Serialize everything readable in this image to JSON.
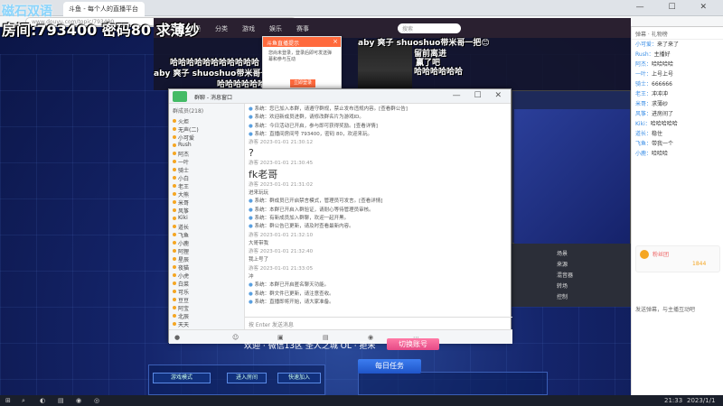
{
  "overlay": {
    "room_label": "房间:",
    "room_number": "793400",
    "password_label": "密码",
    "password_value": "80",
    "request_text": "求薄纱",
    "logo_text": "磁石双语"
  },
  "browser": {
    "tab_title": "斗鱼 - 每个人的直播平台",
    "url": "www.douyu.com/topic/793400",
    "window_controls": "— ☐ ✕"
  },
  "danmaku": {
    "nav_items": [
      "首页",
      "直播",
      "分类",
      "游戏",
      "娱乐",
      "赛事"
    ],
    "search_placeholder": "搜索",
    "lines": [
      "aby 爽子 shuoshuo带米哥一把😊",
      "哈哈哈哈哈哈哈哈哈哈哈",
      "aby 爽子 shuoshuo带米哥一把",
      "哈哈哈哈哈哈",
      "哈哈哈哈哈哈",
      "留前离进",
      "赢了吧"
    ]
  },
  "popup": {
    "title": "斗鱼直播提示",
    "body": "您尚未登录，登录后即可发送弹幕和参与互动",
    "button": "立即登录",
    "close": "×"
  },
  "qq": {
    "title": "群聊 - 消息窗口",
    "controls": "— ☐ ✕",
    "members_header": "群成员(218)",
    "members": [
      "火炬",
      "无声(二)",
      "小可爱",
      "Rush",
      "阿杰",
      "一叶",
      "骑士",
      "小白",
      "老王",
      "大熊",
      "米哥",
      "风筝",
      "Kiki",
      "道长",
      "飞鱼",
      "小鹿",
      "阿狸",
      "星辰",
      "夜猫",
      "小虎",
      "白菜",
      "可乐",
      "豆豆",
      "阿宝",
      "北辰",
      "天天",
      "木子",
      "小七",
      "毛毛",
      "团团",
      "果冻"
    ],
    "messages": [
      {
        "cls": "sys",
        "text": "系统：您已加入本群，请遵守群规，禁止发布违规内容。[查看群公告]"
      },
      {
        "cls": "sys",
        "text": "系统：欢迎新成员进群，请修改群名片为游戏ID。"
      },
      {
        "cls": "sys",
        "text": "系统：今日活动已开启，参与即可获得奖励。[查看详情]"
      },
      {
        "cls": "sys",
        "text": "系统：直播间房间号 793400，密码 80，欢迎来玩。"
      },
      {
        "cls": "name",
        "text": "游客 2023-01-01 21:30:12"
      },
      {
        "cls": "big",
        "text": "?"
      },
      {
        "cls": "name",
        "text": "游客 2023-01-01 21:30:45"
      },
      {
        "cls": "big",
        "text": "fk老哥"
      },
      {
        "cls": "name",
        "text": "游客 2023-01-01 21:31:02"
      },
      {
        "cls": "",
        "text": "进来玩玩"
      },
      {
        "cls": "sys",
        "text": "系统：群成员已开启禁言模式，管理员可发言。[查看详情]"
      },
      {
        "cls": "sys",
        "text": "系统：本群已开启入群验证，请耐心等待管理员审核。"
      },
      {
        "cls": "sys",
        "text": "系统：有新成员加入群聊，欢迎一起开黑。"
      },
      {
        "cls": "sys",
        "text": "系统：群公告已更新，请及时查看最新内容。"
      },
      {
        "cls": "name",
        "text": "游客 2023-01-01 21:32:10"
      },
      {
        "cls": "",
        "text": "大哥带我"
      },
      {
        "cls": "name",
        "text": "游客 2023-01-01 21:32:40"
      },
      {
        "cls": "",
        "text": "我上号了"
      },
      {
        "cls": "name",
        "text": "游客 2023-01-01 21:33:05"
      },
      {
        "cls": "",
        "text": "冲"
      },
      {
        "cls": "sys",
        "text": "系统：本群已开启匿名聊天功能。"
      },
      {
        "cls": "sys",
        "text": "系统：群文件已更新，请注意查收。"
      },
      {
        "cls": "sys",
        "text": "系统：直播即将开始，请大家准备。"
      }
    ],
    "input_placeholder": "按 Enter 发送消息"
  },
  "obs": {
    "rows": [
      "场景",
      "来源",
      "混音器",
      "转场",
      "控制"
    ]
  },
  "chat": {
    "header": "弹幕 · 礼物榜",
    "messages": [
      {
        "user": "小可爱：",
        "text": "来了来了"
      },
      {
        "user": "Rush：",
        "text": "主播好"
      },
      {
        "user": "阿杰：",
        "text": "哈哈哈哈"
      },
      {
        "user": "一叶：",
        "text": "上号上号"
      },
      {
        "user": "骑士：",
        "text": "666666"
      },
      {
        "user": "老王：",
        "text": "冲冲冲"
      },
      {
        "user": "米哥：",
        "text": "求薄纱"
      },
      {
        "user": "风筝：",
        "text": "进房间了"
      },
      {
        "user": "Kiki：",
        "text": "哈哈哈哈哈"
      },
      {
        "user": "道长：",
        "text": "稳住"
      },
      {
        "user": "飞鱼：",
        "text": "带我一个"
      },
      {
        "user": "小鹿：",
        "text": "哈哈哈"
      }
    ],
    "card_name": "粉丝团",
    "card_value": "1844",
    "bottom_text": "发送弹幕，与主播互动吧"
  },
  "game": {
    "bar_text": "欢迎 · 微信13区 圣人之城 OL · 拒米",
    "switch_button": "切换账号",
    "daily_tasks": "每日任务",
    "left_buttons": [
      "游戏模式",
      "进入房间",
      "快速加入"
    ]
  },
  "taskbar": {
    "time": "21:33",
    "date": "2023/1/1"
  }
}
